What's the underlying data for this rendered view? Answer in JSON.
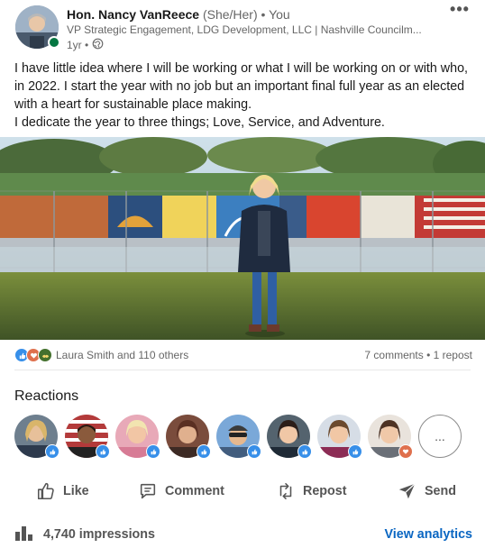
{
  "author": {
    "name": "Hon. Nancy VanReece",
    "pronouns": "(She/Her)",
    "relation": "• You",
    "headline": "VP Strategic Engagement, LDG Development, LLC | Nashville Councilm...",
    "time": "1yr •",
    "visibility_icon": "globe-icon"
  },
  "post": {
    "lines": [
      "I have little idea where I will be working or what I will be working on or with who, in 2022. I start the year with no job but an important final full year as an elected with a heart for sustainable place making.",
      "I dedicate the year to three things; Love, Service, and Adventure."
    ]
  },
  "social": {
    "reactors_text": "Laura Smith and 110 others",
    "comments_reposts": "7 comments • 1 repost"
  },
  "reactions": {
    "title": "Reactions",
    "more_label": "..."
  },
  "actions": {
    "like": "Like",
    "comment": "Comment",
    "repost": "Repost",
    "send": "Send"
  },
  "footer": {
    "impressions": "4,740 impressions",
    "analytics": "View analytics"
  },
  "colors": {
    "accent": "#0a66c2",
    "like_blue": "#378fe9",
    "love_red": "#df704d",
    "support_green": "#44712e",
    "presence_green": "#057642"
  }
}
